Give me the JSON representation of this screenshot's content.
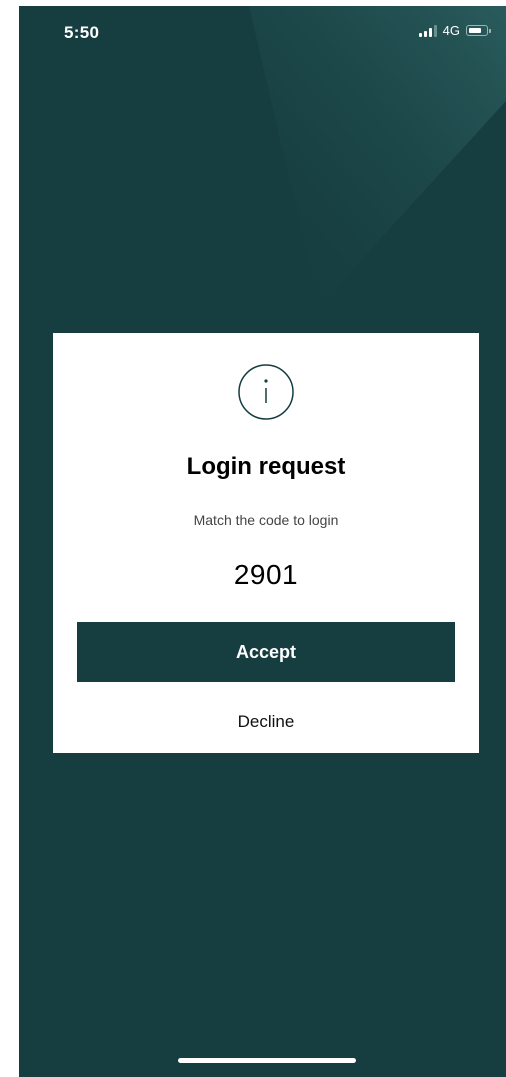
{
  "status_bar": {
    "time": "5:50",
    "network": "4G"
  },
  "dialog": {
    "icon": "info-icon",
    "title": "Login request",
    "subtitle": "Match the code to login",
    "code": "2901",
    "accept_label": "Accept",
    "decline_label": "Decline"
  },
  "colors": {
    "background": "#163d40",
    "accent": "#163d40",
    "dialog_background": "#ffffff"
  }
}
